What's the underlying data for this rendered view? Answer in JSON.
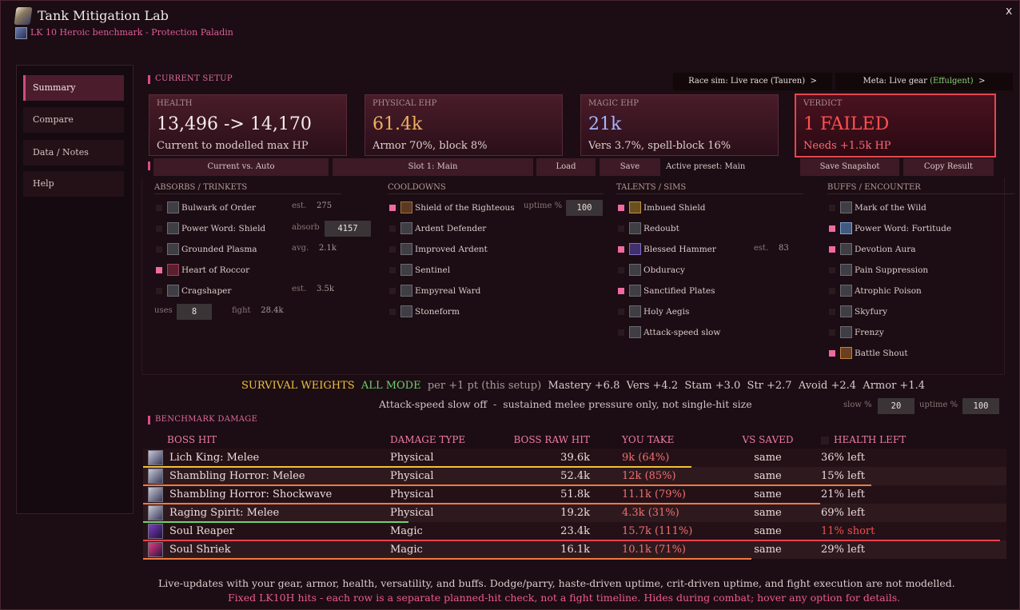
{
  "window": {
    "title": "Tank Mitigation Lab",
    "subtitle": "LK 10 Heroic benchmark - Protection Paladin",
    "close": "x"
  },
  "sidebar": {
    "items": [
      {
        "label": "Summary",
        "active": true
      },
      {
        "label": "Compare"
      },
      {
        "label": "Data / Notes"
      },
      {
        "label": "Help"
      }
    ]
  },
  "current_setup": {
    "heading": "CURRENT SETUP",
    "race_sim_label": "Race sim: Live race (Tauren)",
    "race_sim_chevron": ">",
    "meta_label": "Meta: Live gear",
    "meta_value": "(Effulgent)",
    "meta_chevron": ">"
  },
  "cards": {
    "health": {
      "label": "HEALTH",
      "value": "13,496 -> 14,170",
      "detail": "Current to modelled max HP",
      "color": "#f4ecec"
    },
    "physical": {
      "label": "PHYSICAL EHP",
      "value": "61.4k",
      "detail": "Armor 70%, block 8%",
      "color": "#f0b060"
    },
    "magic": {
      "label": "MAGIC EHP",
      "value": "21k",
      "detail": "Vers 3.7%, spell-block 16%",
      "color": "#a8b4ff"
    },
    "verdict": {
      "label": "VERDICT",
      "value": "1 FAILED",
      "detail": "Needs +1.5k HP",
      "color": "#ff5050"
    }
  },
  "toolbar": {
    "compare_mode": "Current vs. Auto",
    "slot": "Slot 1: Main",
    "load": "Load",
    "save": "Save",
    "active_preset": "Active preset: Main",
    "save_snapshot": "Save Snapshot",
    "copy_result": "Copy Result"
  },
  "absorbs": {
    "heading": "ABSORBS / TRINKETS",
    "items": [
      {
        "label": "Bulwark of Order",
        "checked": false
      },
      {
        "label": "Power Word: Shield",
        "checked": false
      },
      {
        "label": "Grounded Plasma",
        "checked": false
      },
      {
        "label": "Heart of Roccor",
        "checked": true
      },
      {
        "label": "Cragshaper",
        "checked": false
      }
    ],
    "est1_label": "est.",
    "est1_value": "275",
    "absorb_label": "absorb",
    "absorb_value": "4157",
    "avg_label": "avg.",
    "avg_value": "2.1k",
    "est2_label": "est.",
    "est2_value": "3.5k",
    "uses_label": "uses",
    "uses_value": "8",
    "fight_label": "fight",
    "fight_value": "28.4k"
  },
  "cooldowns": {
    "heading": "COOLDOWNS",
    "uptime_label": "uptime %",
    "uptime_value": "100",
    "items": [
      {
        "label": "Shield of the Righteous",
        "checked": true
      },
      {
        "label": "Ardent Defender",
        "checked": false
      },
      {
        "label": "Improved Ardent",
        "checked": false
      },
      {
        "label": "Sentinel",
        "checked": false
      },
      {
        "label": "Empyreal Ward",
        "checked": false
      },
      {
        "label": "Stoneform",
        "checked": false
      }
    ]
  },
  "talents": {
    "heading": "TALENTS / SIMS",
    "est_label": "est.",
    "est_value": "83",
    "items": [
      {
        "label": "Imbued Shield",
        "checked": true
      },
      {
        "label": "Redoubt",
        "checked": false
      },
      {
        "label": "Blessed Hammer",
        "checked": true
      },
      {
        "label": "Obduracy",
        "checked": false
      },
      {
        "label": "Sanctified Plates",
        "checked": true
      },
      {
        "label": "Holy Aegis",
        "checked": false
      },
      {
        "label": "Attack-speed slow",
        "checked": false
      }
    ]
  },
  "buffs": {
    "heading": "BUFFS / ENCOUNTER",
    "items": [
      {
        "label": "Mark of the Wild",
        "checked": false
      },
      {
        "label": "Power Word: Fortitude",
        "checked": true
      },
      {
        "label": "Devotion Aura",
        "checked": true
      },
      {
        "label": "Pain Suppression",
        "checked": false
      },
      {
        "label": "Atrophic Poison",
        "checked": false
      },
      {
        "label": "Skyfury",
        "checked": false
      },
      {
        "label": "Frenzy",
        "checked": false
      },
      {
        "label": "Battle Shout",
        "checked": true
      }
    ]
  },
  "weights": {
    "title": "SURVIVAL WEIGHTS",
    "mode": "ALL MODE",
    "per": "per +1 pt (this setup)",
    "values": "Mastery +6.8  Vers +4.2  Stam +3.0  Str +2.7  Avoid +2.4  Armor +1.4",
    "note": "Attack-speed slow off  -  sustained melee pressure only, not single-hit size",
    "slow_label": "slow %",
    "slow_value": "20",
    "uptime_label": "uptime %",
    "uptime_value": "100"
  },
  "benchmark": {
    "heading": "BENCHMARK DAMAGE",
    "columns": [
      "BOSS HIT",
      "DAMAGE TYPE",
      "BOSS RAW HIT",
      "YOU TAKE",
      "VS SAVED",
      "HEALTH LEFT"
    ],
    "rows": [
      {
        "hit": "Lich King: Melee",
        "type": "Physical",
        "raw": "39.6k",
        "take": "9k",
        "pct": "(64%)",
        "saved": "same",
        "left": "36% left",
        "bar": 0.64,
        "bar_color": "#f0c040",
        "icon": "sword"
      },
      {
        "hit": "Shambling Horror: Melee",
        "type": "Physical",
        "raw": "52.4k",
        "take": "12k",
        "pct": "(85%)",
        "saved": "same",
        "left": "15% left",
        "bar": 0.85,
        "bar_color": "#f07a40",
        "icon": "sword"
      },
      {
        "hit": "Shambling Horror: Shockwave",
        "type": "Physical",
        "raw": "51.8k",
        "take": "11.1k",
        "pct": "(79%)",
        "saved": "same",
        "left": "21% left",
        "bar": 0.79,
        "bar_color": "#f07a40",
        "icon": "shock"
      },
      {
        "hit": "Raging Spirit: Melee",
        "type": "Physical",
        "raw": "19.2k",
        "take": "4.3k",
        "pct": "(31%)",
        "saved": "same",
        "left": "69% left",
        "bar": 0.31,
        "bar_color": "#70d070",
        "icon": "sword"
      },
      {
        "hit": "Soul Reaper",
        "type": "Magic",
        "raw": "23.4k",
        "take": "15.7k",
        "pct": "(111%)",
        "saved": "same",
        "left": "11% short",
        "bar": 1.0,
        "bar_color": "#f04050",
        "icon": "magic"
      },
      {
        "hit": "Soul Shriek",
        "type": "Magic",
        "raw": "16.1k",
        "take": "10.1k",
        "pct": "(71%)",
        "saved": "same",
        "left": "29% left",
        "bar": 0.71,
        "bar_color": "#f07a40",
        "icon": "shriek"
      }
    ]
  },
  "footer": {
    "line1": "Live-updates with your gear, armor, health, versatility, and buffs. Dodge/parry, haste-driven uptime, crit-driven uptime, and fight execution are not modelled.",
    "line2": "Fixed LK10H hits - each row is a separate planned-hit check, not a fight timeline. Hides during combat; hover any option for details."
  }
}
